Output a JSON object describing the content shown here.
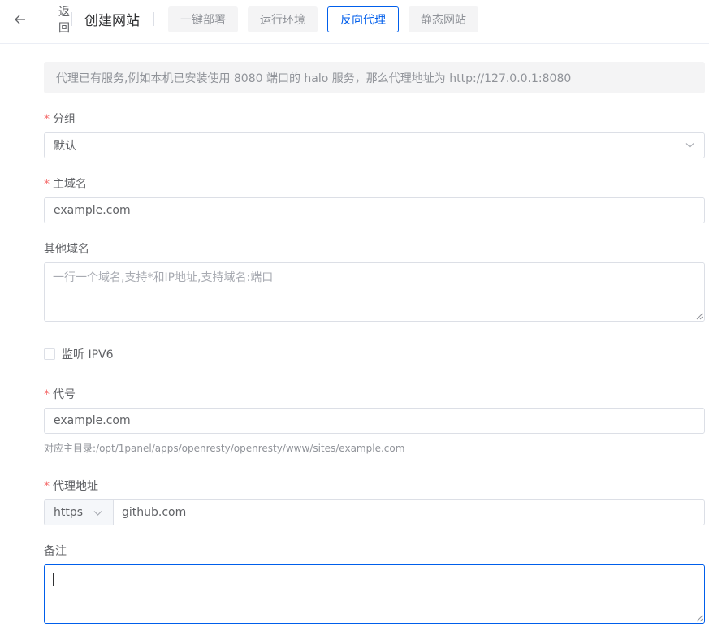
{
  "header": {
    "back_label": "返回",
    "title": "创建网站",
    "tabs": [
      {
        "label": "一键部署",
        "active": false
      },
      {
        "label": "运行环境",
        "active": false
      },
      {
        "label": "反向代理",
        "active": true
      },
      {
        "label": "静态网站",
        "active": false
      }
    ]
  },
  "info_text": "代理已有服务,例如本机已安装使用 8080 端口的 halo 服务，那么代理地址为 http://127.0.0.1:8080",
  "form": {
    "required_mark": "*",
    "group": {
      "label": "分组",
      "value": "默认"
    },
    "primary_domain": {
      "label": "主域名",
      "value": "example.com"
    },
    "other_domains": {
      "label": "其他域名",
      "placeholder": "一行一个域名,支持*和IP地址,支持域名:端口",
      "value": ""
    },
    "ipv6": {
      "label": "监听 IPV6",
      "checked": false
    },
    "alias": {
      "label": "代号",
      "value": "example.com",
      "hint": "对应主目录:/opt/1panel/apps/openresty/openresty/www/sites/example.com"
    },
    "proxy": {
      "label": "代理地址",
      "protocol": "https",
      "value": "github.com"
    },
    "remark": {
      "label": "备注",
      "value": ""
    }
  },
  "colors": {
    "accent": "#005eeb",
    "required": "#f56c6c",
    "tab_bg": "#f4f4f5",
    "border": "#dcdfe6"
  },
  "icons": {
    "back": "arrow-left-icon",
    "select": "chevron-down-icon",
    "resize": "resize-handle-icon"
  }
}
